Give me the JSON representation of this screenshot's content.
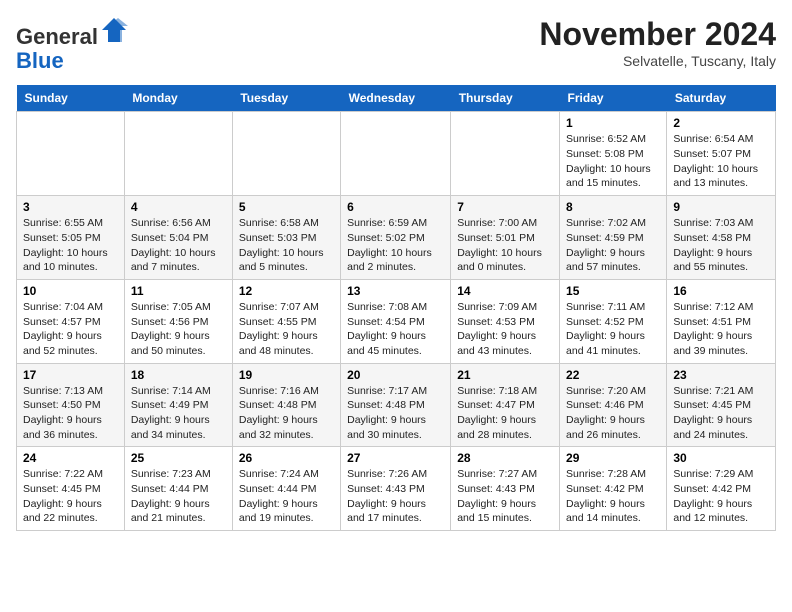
{
  "header": {
    "logo_line1": "General",
    "logo_line2": "Blue",
    "month_title": "November 2024",
    "location": "Selvatelle, Tuscany, Italy"
  },
  "days_of_week": [
    "Sunday",
    "Monday",
    "Tuesday",
    "Wednesday",
    "Thursday",
    "Friday",
    "Saturday"
  ],
  "weeks": [
    [
      {
        "day": "",
        "info": ""
      },
      {
        "day": "",
        "info": ""
      },
      {
        "day": "",
        "info": ""
      },
      {
        "day": "",
        "info": ""
      },
      {
        "day": "",
        "info": ""
      },
      {
        "day": "1",
        "info": "Sunrise: 6:52 AM\nSunset: 5:08 PM\nDaylight: 10 hours and 15 minutes."
      },
      {
        "day": "2",
        "info": "Sunrise: 6:54 AM\nSunset: 5:07 PM\nDaylight: 10 hours and 13 minutes."
      }
    ],
    [
      {
        "day": "3",
        "info": "Sunrise: 6:55 AM\nSunset: 5:05 PM\nDaylight: 10 hours and 10 minutes."
      },
      {
        "day": "4",
        "info": "Sunrise: 6:56 AM\nSunset: 5:04 PM\nDaylight: 10 hours and 7 minutes."
      },
      {
        "day": "5",
        "info": "Sunrise: 6:58 AM\nSunset: 5:03 PM\nDaylight: 10 hours and 5 minutes."
      },
      {
        "day": "6",
        "info": "Sunrise: 6:59 AM\nSunset: 5:02 PM\nDaylight: 10 hours and 2 minutes."
      },
      {
        "day": "7",
        "info": "Sunrise: 7:00 AM\nSunset: 5:01 PM\nDaylight: 10 hours and 0 minutes."
      },
      {
        "day": "8",
        "info": "Sunrise: 7:02 AM\nSunset: 4:59 PM\nDaylight: 9 hours and 57 minutes."
      },
      {
        "day": "9",
        "info": "Sunrise: 7:03 AM\nSunset: 4:58 PM\nDaylight: 9 hours and 55 minutes."
      }
    ],
    [
      {
        "day": "10",
        "info": "Sunrise: 7:04 AM\nSunset: 4:57 PM\nDaylight: 9 hours and 52 minutes."
      },
      {
        "day": "11",
        "info": "Sunrise: 7:05 AM\nSunset: 4:56 PM\nDaylight: 9 hours and 50 minutes."
      },
      {
        "day": "12",
        "info": "Sunrise: 7:07 AM\nSunset: 4:55 PM\nDaylight: 9 hours and 48 minutes."
      },
      {
        "day": "13",
        "info": "Sunrise: 7:08 AM\nSunset: 4:54 PM\nDaylight: 9 hours and 45 minutes."
      },
      {
        "day": "14",
        "info": "Sunrise: 7:09 AM\nSunset: 4:53 PM\nDaylight: 9 hours and 43 minutes."
      },
      {
        "day": "15",
        "info": "Sunrise: 7:11 AM\nSunset: 4:52 PM\nDaylight: 9 hours and 41 minutes."
      },
      {
        "day": "16",
        "info": "Sunrise: 7:12 AM\nSunset: 4:51 PM\nDaylight: 9 hours and 39 minutes."
      }
    ],
    [
      {
        "day": "17",
        "info": "Sunrise: 7:13 AM\nSunset: 4:50 PM\nDaylight: 9 hours and 36 minutes."
      },
      {
        "day": "18",
        "info": "Sunrise: 7:14 AM\nSunset: 4:49 PM\nDaylight: 9 hours and 34 minutes."
      },
      {
        "day": "19",
        "info": "Sunrise: 7:16 AM\nSunset: 4:48 PM\nDaylight: 9 hours and 32 minutes."
      },
      {
        "day": "20",
        "info": "Sunrise: 7:17 AM\nSunset: 4:48 PM\nDaylight: 9 hours and 30 minutes."
      },
      {
        "day": "21",
        "info": "Sunrise: 7:18 AM\nSunset: 4:47 PM\nDaylight: 9 hours and 28 minutes."
      },
      {
        "day": "22",
        "info": "Sunrise: 7:20 AM\nSunset: 4:46 PM\nDaylight: 9 hours and 26 minutes."
      },
      {
        "day": "23",
        "info": "Sunrise: 7:21 AM\nSunset: 4:45 PM\nDaylight: 9 hours and 24 minutes."
      }
    ],
    [
      {
        "day": "24",
        "info": "Sunrise: 7:22 AM\nSunset: 4:45 PM\nDaylight: 9 hours and 22 minutes."
      },
      {
        "day": "25",
        "info": "Sunrise: 7:23 AM\nSunset: 4:44 PM\nDaylight: 9 hours and 21 minutes."
      },
      {
        "day": "26",
        "info": "Sunrise: 7:24 AM\nSunset: 4:44 PM\nDaylight: 9 hours and 19 minutes."
      },
      {
        "day": "27",
        "info": "Sunrise: 7:26 AM\nSunset: 4:43 PM\nDaylight: 9 hours and 17 minutes."
      },
      {
        "day": "28",
        "info": "Sunrise: 7:27 AM\nSunset: 4:43 PM\nDaylight: 9 hours and 15 minutes."
      },
      {
        "day": "29",
        "info": "Sunrise: 7:28 AM\nSunset: 4:42 PM\nDaylight: 9 hours and 14 minutes."
      },
      {
        "day": "30",
        "info": "Sunrise: 7:29 AM\nSunset: 4:42 PM\nDaylight: 9 hours and 12 minutes."
      }
    ]
  ]
}
